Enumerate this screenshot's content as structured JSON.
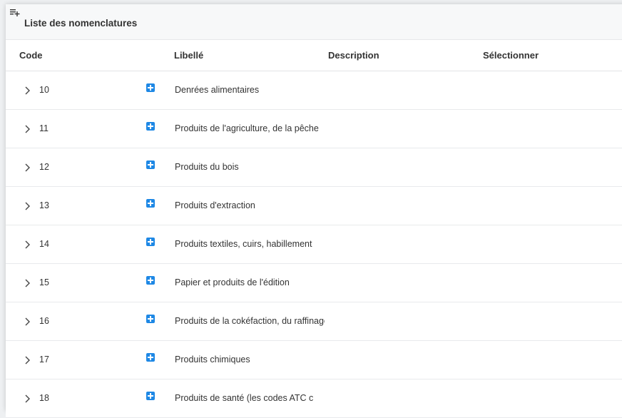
{
  "panel": {
    "title": "Liste des nomenclatures",
    "title_icon": "playlist-add-icon"
  },
  "columns": {
    "code": "Code",
    "libelle": "Libellé",
    "description": "Description",
    "select": "Sélectionner"
  },
  "rows": [
    {
      "code": "10",
      "libelle": "Denrées alimentaires"
    },
    {
      "code": "11",
      "libelle": "Produits de l'agriculture, de la pêche"
    },
    {
      "code": "12",
      "libelle": "Produits du bois"
    },
    {
      "code": "13",
      "libelle": "Produits d'extraction"
    },
    {
      "code": "14",
      "libelle": "Produits textiles, cuirs, habillement"
    },
    {
      "code": "15",
      "libelle": "Papier et produits de l'édition"
    },
    {
      "code": "16",
      "libelle": "Produits de la cokéfaction, du raffinage"
    },
    {
      "code": "17",
      "libelle": "Produits chimiques"
    },
    {
      "code": "18",
      "libelle": "Produits de santé (les codes ATC c"
    }
  ],
  "colors": {
    "accent": "#1e88e5",
    "header_bg": "#f7f8f9"
  }
}
